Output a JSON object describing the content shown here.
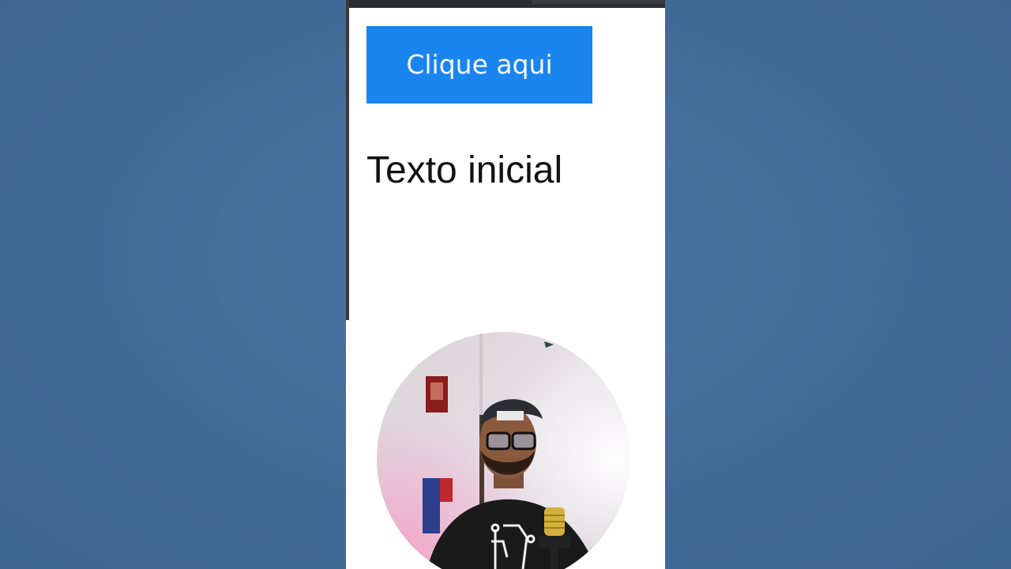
{
  "page": {
    "button_label": "Clique aqui",
    "text_paragraph": "Texto inicial"
  },
  "overlay": {
    "webcam_icon": "presenter-webcam"
  },
  "colors": {
    "background": "#436c99",
    "button": "#1a84ef",
    "button_text": "#f5fbff",
    "page_background": "#ffffff",
    "text": "#111111"
  }
}
